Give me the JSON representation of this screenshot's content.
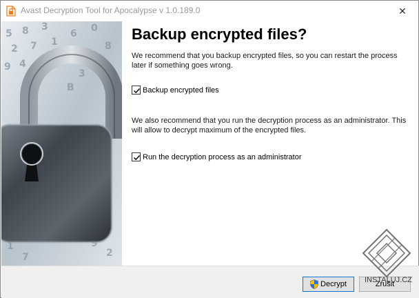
{
  "window": {
    "title": "Avast Decryption Tool for Apocalypse v 1.0.189.0",
    "close_glyph": "✕",
    "app_icon": "avast-app-icon"
  },
  "side_image": {
    "description_icon": "padlock-illustration"
  },
  "main": {
    "heading": "Backup encrypted files?",
    "para1": "We recommend that you backup encrypted files, so you can restart the process later if something goes wrong.",
    "checkbox_backup": {
      "label": "Backup encrypted files",
      "checked": true
    },
    "para2": "We also recommend that you run the decryption process as an administrator. This will allow to decrypt maximum of the encrypted files.",
    "checkbox_admin": {
      "label": "Run the decryption process as an administrator",
      "checked": true
    }
  },
  "footer": {
    "decrypt_label": "Decrypt",
    "cancel_label": "Zrušit"
  },
  "watermark": {
    "text": "INSTALUJ.CZ"
  },
  "colors": {
    "accent": "#0078d7",
    "footer_bg": "#f0f0f0",
    "app_icon": "#f07a1a"
  }
}
